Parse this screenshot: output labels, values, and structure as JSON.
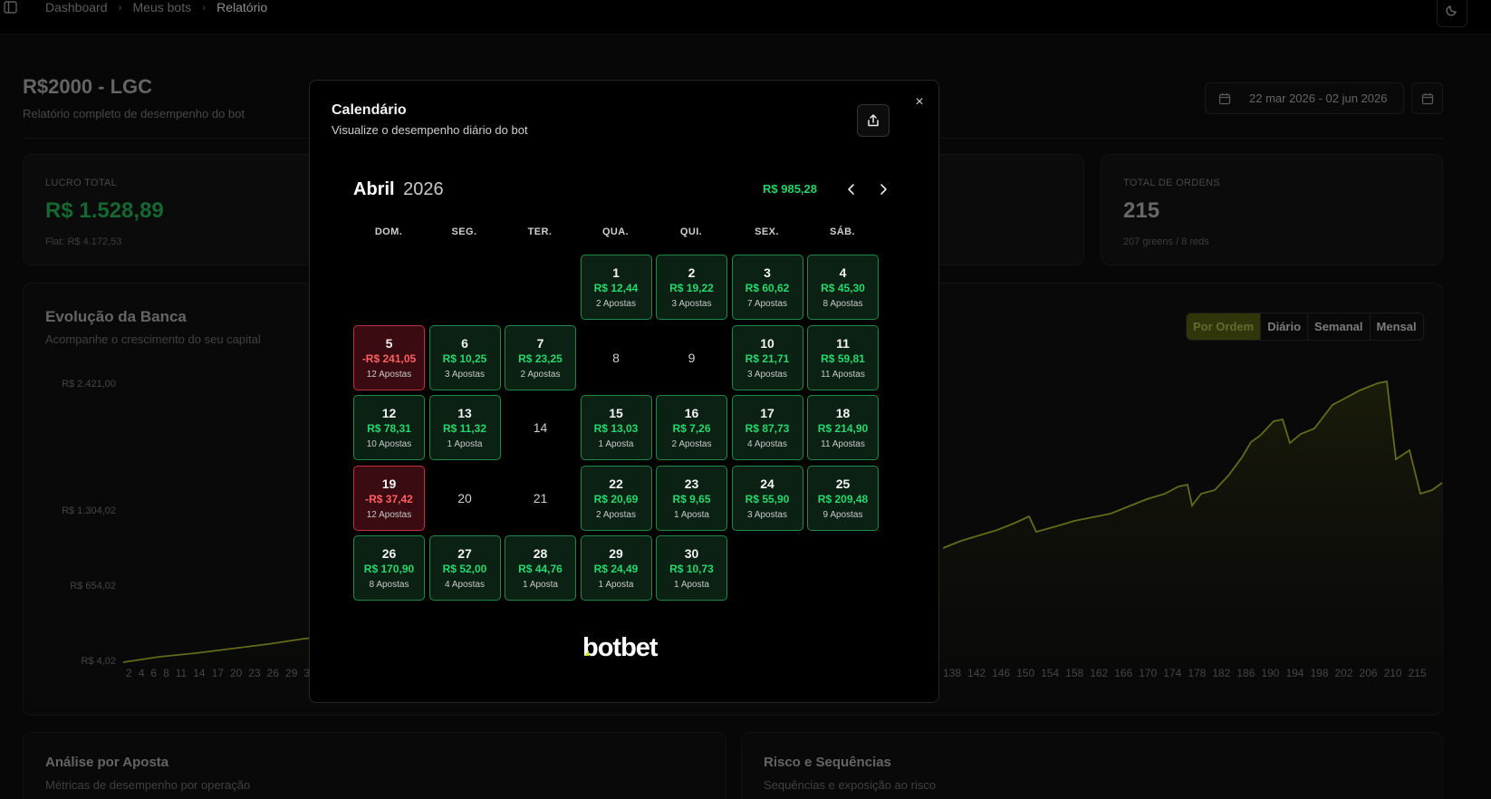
{
  "breadcrumb": [
    "Dashboard",
    "Meus bots",
    "Relatório"
  ],
  "header": {
    "title": "R$2000 - LGC",
    "subtitle": "Relatório completo de desempenho do bot",
    "date_range": "22 mar 2026 - 02 jun 2026"
  },
  "stats": {
    "lucro_label": "LUCRO TOTAL",
    "lucro_value": "R$ 1.528,89",
    "lucro_sub": "Flat: R$ 4.172,53",
    "ordens_label": "TOTAL DE ORDENS",
    "ordens_value": "215",
    "ordens_sub": "207 greens / 8 reds"
  },
  "bank_chart": {
    "title": "Evolução da Banca",
    "subtitle": "Acompanhe o crescimento do seu capital",
    "tabs": [
      "Por Ordem",
      "Diário",
      "Semanal",
      "Mensal"
    ],
    "active_tab": "Por Ordem",
    "y_ticks": [
      "R$ 2.421,00",
      "R$ 1.304,02",
      "R$ 654,02",
      "R$ 4,02"
    ],
    "x_ticks_left": [
      "2",
      "4",
      "6",
      "8",
      "11",
      "14",
      "17",
      "20",
      "23",
      "26",
      "29",
      "3"
    ],
    "x_ticks_right": [
      "138",
      "142",
      "146",
      "150",
      "154",
      "158",
      "162",
      "166",
      "170",
      "174",
      "178",
      "182",
      "186",
      "190",
      "194",
      "198",
      "202",
      "206",
      "210",
      "215"
    ],
    "line_color": "#9aa22a"
  },
  "bottom": {
    "left_title": "Análise por Aposta",
    "left_sub": "Métricas de desempenho por operação",
    "right_title": "Risco e Sequências",
    "right_sub": "Sequências e exposição ao risco"
  },
  "modal": {
    "title": "Calendário",
    "subtitle": "Visualize o desempenho diário do bot",
    "close_label": "×",
    "month": "Abril",
    "year": "2026",
    "month_total": "R$ 985,28",
    "weekdays": [
      "DOM.",
      "SEG.",
      "TER.",
      "QUA.",
      "QUI.",
      "SEX.",
      "SÁB."
    ],
    "logo_text": "botbet",
    "days": [
      {
        "day": "1",
        "value": "R$ 12,44",
        "bets": "2 Apostas",
        "status": "win"
      },
      {
        "day": "2",
        "value": "R$ 19,22",
        "bets": "3 Apostas",
        "status": "win"
      },
      {
        "day": "3",
        "value": "R$ 60,62",
        "bets": "7 Apostas",
        "status": "win"
      },
      {
        "day": "4",
        "value": "R$ 45,30",
        "bets": "8 Apostas",
        "status": "win"
      },
      {
        "day": "5",
        "value": "-R$ 241,05",
        "bets": "12 Apostas",
        "status": "loss"
      },
      {
        "day": "6",
        "value": "R$ 10,25",
        "bets": "3 Apostas",
        "status": "win"
      },
      {
        "day": "7",
        "value": "R$ 23,25",
        "bets": "2 Apostas",
        "status": "win"
      },
      {
        "day": "8",
        "value": "",
        "bets": "",
        "status": "empty"
      },
      {
        "day": "9",
        "value": "",
        "bets": "",
        "status": "empty"
      },
      {
        "day": "10",
        "value": "R$ 21,71",
        "bets": "3 Apostas",
        "status": "win"
      },
      {
        "day": "11",
        "value": "R$ 59,81",
        "bets": "11 Apostas",
        "status": "win"
      },
      {
        "day": "12",
        "value": "R$ 78,31",
        "bets": "10 Apostas",
        "status": "win"
      },
      {
        "day": "13",
        "value": "R$ 11,32",
        "bets": "1 Aposta",
        "status": "win"
      },
      {
        "day": "14",
        "value": "",
        "bets": "",
        "status": "empty"
      },
      {
        "day": "15",
        "value": "R$ 13,03",
        "bets": "1 Aposta",
        "status": "win"
      },
      {
        "day": "16",
        "value": "R$ 7,26",
        "bets": "2 Apostas",
        "status": "win"
      },
      {
        "day": "17",
        "value": "R$ 87,73",
        "bets": "4 Apostas",
        "status": "win"
      },
      {
        "day": "18",
        "value": "R$ 214,90",
        "bets": "11 Apostas",
        "status": "win"
      },
      {
        "day": "19",
        "value": "-R$ 37,42",
        "bets": "12 Apostas",
        "status": "loss"
      },
      {
        "day": "20",
        "value": "",
        "bets": "",
        "status": "empty"
      },
      {
        "day": "21",
        "value": "",
        "bets": "",
        "status": "empty"
      },
      {
        "day": "22",
        "value": "R$ 20,69",
        "bets": "2 Apostas",
        "status": "win"
      },
      {
        "day": "23",
        "value": "R$ 9,65",
        "bets": "1 Aposta",
        "status": "win"
      },
      {
        "day": "24",
        "value": "R$ 55,90",
        "bets": "3 Apostas",
        "status": "win"
      },
      {
        "day": "25",
        "value": "R$ 209,48",
        "bets": "9 Apostas",
        "status": "win"
      },
      {
        "day": "26",
        "value": "R$ 170,90",
        "bets": "8 Apostas",
        "status": "win"
      },
      {
        "day": "27",
        "value": "R$ 52,00",
        "bets": "4 Apostas",
        "status": "win"
      },
      {
        "day": "28",
        "value": "R$ 44,76",
        "bets": "1 Aposta",
        "status": "win"
      },
      {
        "day": "29",
        "value": "R$ 24,49",
        "bets": "1 Aposta",
        "status": "win"
      },
      {
        "day": "30",
        "value": "R$ 10,73",
        "bets": "1 Aposta",
        "status": "win"
      }
    ]
  }
}
